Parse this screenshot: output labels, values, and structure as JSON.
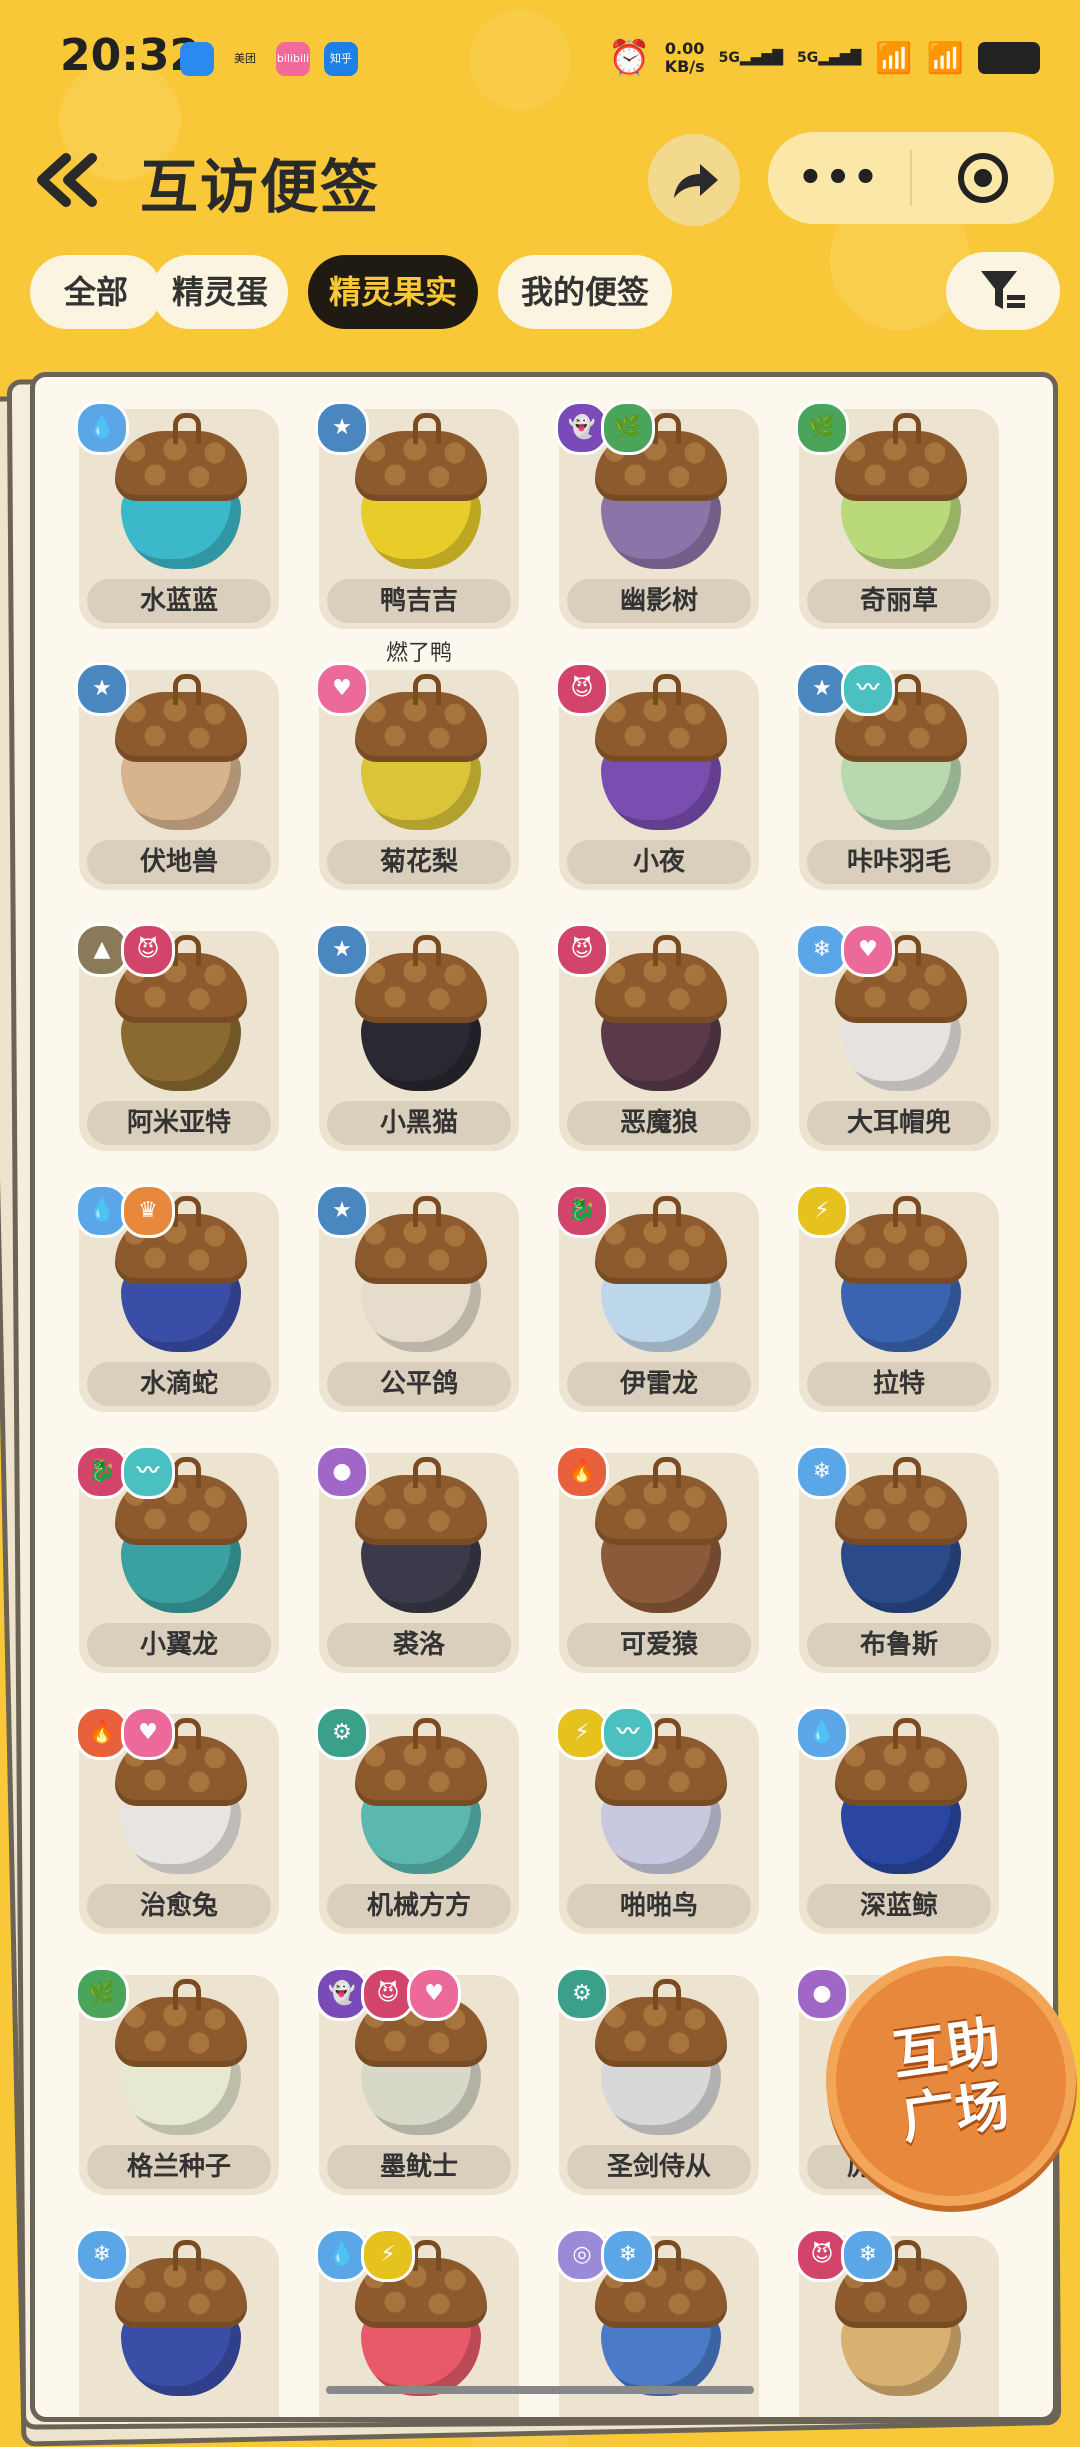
{
  "status_bar": {
    "time": "20:32",
    "apps": [
      "",
      "美团",
      "bilibili",
      "知乎"
    ],
    "net_speed_value": "0.00",
    "net_speed_unit": "KB/s",
    "sim1": "5G",
    "sim2": "5G"
  },
  "header": {
    "title": "互访便签"
  },
  "tabs": [
    {
      "label": "全部",
      "active": false
    },
    {
      "label": "精灵蛋",
      "active": false
    },
    {
      "label": "精灵果实",
      "active": true
    },
    {
      "label": "我的便签",
      "active": false
    }
  ],
  "items": [
    {
      "name": "水蓝蓝",
      "nut": "#3bb8c9",
      "badges": [
        {
          "icon": "water-icon",
          "color": "#5aa6e6"
        }
      ]
    },
    {
      "name": "鸭吉吉",
      "nut": "#e7cc2a",
      "owner": "燃了鸭",
      "badges": [
        {
          "icon": "normal-icon",
          "color": "#4a86c0"
        }
      ]
    },
    {
      "name": "幽影树",
      "nut": "#8a74a8",
      "badges": [
        {
          "icon": "ghost-icon",
          "color": "#7a4ab8"
        },
        {
          "icon": "grass-icon",
          "color": "#4aa45a"
        }
      ]
    },
    {
      "name": "奇丽草",
      "nut": "#b9d97a",
      "badges": [
        {
          "icon": "grass-icon",
          "color": "#4aa45a"
        }
      ]
    },
    {
      "name": "伏地兽",
      "nut": "#d7b48e",
      "badges": [
        {
          "icon": "normal-icon",
          "color": "#4a86c0"
        }
      ]
    },
    {
      "name": "菊花梨",
      "nut": "#d9c43a",
      "badges": [
        {
          "icon": "fairy-icon",
          "color": "#ec6a9a"
        }
      ]
    },
    {
      "name": "小夜",
      "nut": "#7a4eb0",
      "badges": [
        {
          "icon": "demon-icon",
          "color": "#d2446a"
        }
      ]
    },
    {
      "name": "咔咔羽毛",
      "nut": "#b8d8b0",
      "badges": [
        {
          "icon": "normal-icon",
          "color": "#4a86c0"
        },
        {
          "icon": "wing-icon",
          "color": "#4ac0c0"
        }
      ]
    },
    {
      "name": "阿米亚特",
      "nut": "#8a6a30",
      "badges": [
        {
          "icon": "ground-icon",
          "color": "#8a7a5a"
        },
        {
          "icon": "demon-icon",
          "color": "#d2446a"
        }
      ]
    },
    {
      "name": "小黑猫",
      "nut": "#2a2830",
      "badges": [
        {
          "icon": "normal-icon",
          "color": "#4a86c0"
        }
      ]
    },
    {
      "name": "恶魔狼",
      "nut": "#5a3a4a",
      "badges": [
        {
          "icon": "demon-icon",
          "color": "#d2446a"
        }
      ]
    },
    {
      "name": "大耳帽兜",
      "nut": "#e6e2e0",
      "badges": [
        {
          "icon": "ice-icon",
          "color": "#5aa6e6"
        },
        {
          "icon": "fairy-icon",
          "color": "#ec6a9a"
        }
      ]
    },
    {
      "name": "水滴蛇",
      "nut": "#3a4ea8",
      "badges": [
        {
          "icon": "water-icon",
          "color": "#5aa6e6"
        },
        {
          "icon": "crown-icon",
          "color": "#e8883c"
        }
      ]
    },
    {
      "name": "公平鸽",
      "nut": "#e6dccc",
      "badges": [
        {
          "icon": "normal-icon",
          "color": "#4a86c0"
        }
      ]
    },
    {
      "name": "伊雷龙",
      "nut": "#bcd6ea",
      "badges": [
        {
          "icon": "dragon-icon",
          "color": "#d2446a"
        }
      ]
    },
    {
      "name": "拉特",
      "nut": "#3a64b0",
      "badges": [
        {
          "icon": "electric-icon",
          "color": "#e6c21e"
        }
      ]
    },
    {
      "name": "小翼龙",
      "nut": "#3aa0a0",
      "badges": [
        {
          "icon": "dragon-icon",
          "color": "#d2446a"
        },
        {
          "icon": "wing-icon",
          "color": "#4ac0c0"
        }
      ]
    },
    {
      "name": "裘洛",
      "nut": "#3a3a4a",
      "badges": [
        {
          "icon": "poison-icon",
          "color": "#a066c8"
        }
      ]
    },
    {
      "name": "可爱猿",
      "nut": "#8a5a3a",
      "badges": [
        {
          "icon": "fire-icon",
          "color": "#e8603c"
        }
      ]
    },
    {
      "name": "布鲁斯",
      "nut": "#2a4a8a",
      "badges": [
        {
          "icon": "ice-icon",
          "color": "#5aa6e6"
        }
      ]
    },
    {
      "name": "治愈兔",
      "nut": "#e8e4e2",
      "badges": [
        {
          "icon": "fire-icon",
          "color": "#e8603c"
        },
        {
          "icon": "fairy-icon",
          "color": "#ec6a9a"
        }
      ]
    },
    {
      "name": "机械方方",
      "nut": "#5ab8b0",
      "badges": [
        {
          "icon": "gear-icon",
          "color": "#3aa08a"
        }
      ]
    },
    {
      "name": "啪啪鸟",
      "nut": "#c8c8e0",
      "badges": [
        {
          "icon": "electric-icon",
          "color": "#e6c21e"
        },
        {
          "icon": "wing-icon",
          "color": "#4ac0c0"
        }
      ]
    },
    {
      "name": "深蓝鲸",
      "nut": "#2a46a0",
      "badges": [
        {
          "icon": "water-icon",
          "color": "#5aa6e6"
        }
      ]
    },
    {
      "name": "格兰种子",
      "nut": "#e6e8d0",
      "badges": [
        {
          "icon": "grass-icon",
          "color": "#4aa45a"
        }
      ]
    },
    {
      "name": "墨鱿士",
      "nut": "#d8d8c8",
      "badges": [
        {
          "icon": "ghost-icon",
          "color": "#7a4ab8"
        },
        {
          "icon": "demon-icon",
          "color": "#d2446a"
        },
        {
          "icon": "fairy-icon",
          "color": "#ec6a9a"
        }
      ]
    },
    {
      "name": "圣剑侍从",
      "nut": "#d8d8d8",
      "badges": [
        {
          "icon": "gear-icon",
          "color": "#3aa08a"
        }
      ]
    },
    {
      "name": "厉毒小萝",
      "nut": "#6a5aa0",
      "badges": [
        {
          "icon": "poison-icon",
          "color": "#a066c8"
        }
      ]
    },
    {
      "name": "",
      "nut": "#3a4ea8",
      "badges": [
        {
          "icon": "ice-icon",
          "color": "#5aa6e6"
        }
      ]
    },
    {
      "name": "",
      "nut": "#e85a6a",
      "badges": [
        {
          "icon": "water-icon",
          "color": "#5aa6e6"
        },
        {
          "icon": "electric-icon",
          "color": "#e6c21e"
        }
      ]
    },
    {
      "name": "",
      "nut": "#4a7ac8",
      "badges": [
        {
          "icon": "psychic-icon",
          "color": "#9a8ad8"
        },
        {
          "icon": "ice-icon",
          "color": "#5aa6e6"
        }
      ]
    },
    {
      "name": "",
      "nut": "#d8b070",
      "badges": [
        {
          "icon": "demon-icon",
          "color": "#d2446a"
        },
        {
          "icon": "ice-icon",
          "color": "#5aa6e6"
        }
      ]
    }
  ],
  "plaza_button": {
    "line1": "互助",
    "line2": "广场"
  }
}
